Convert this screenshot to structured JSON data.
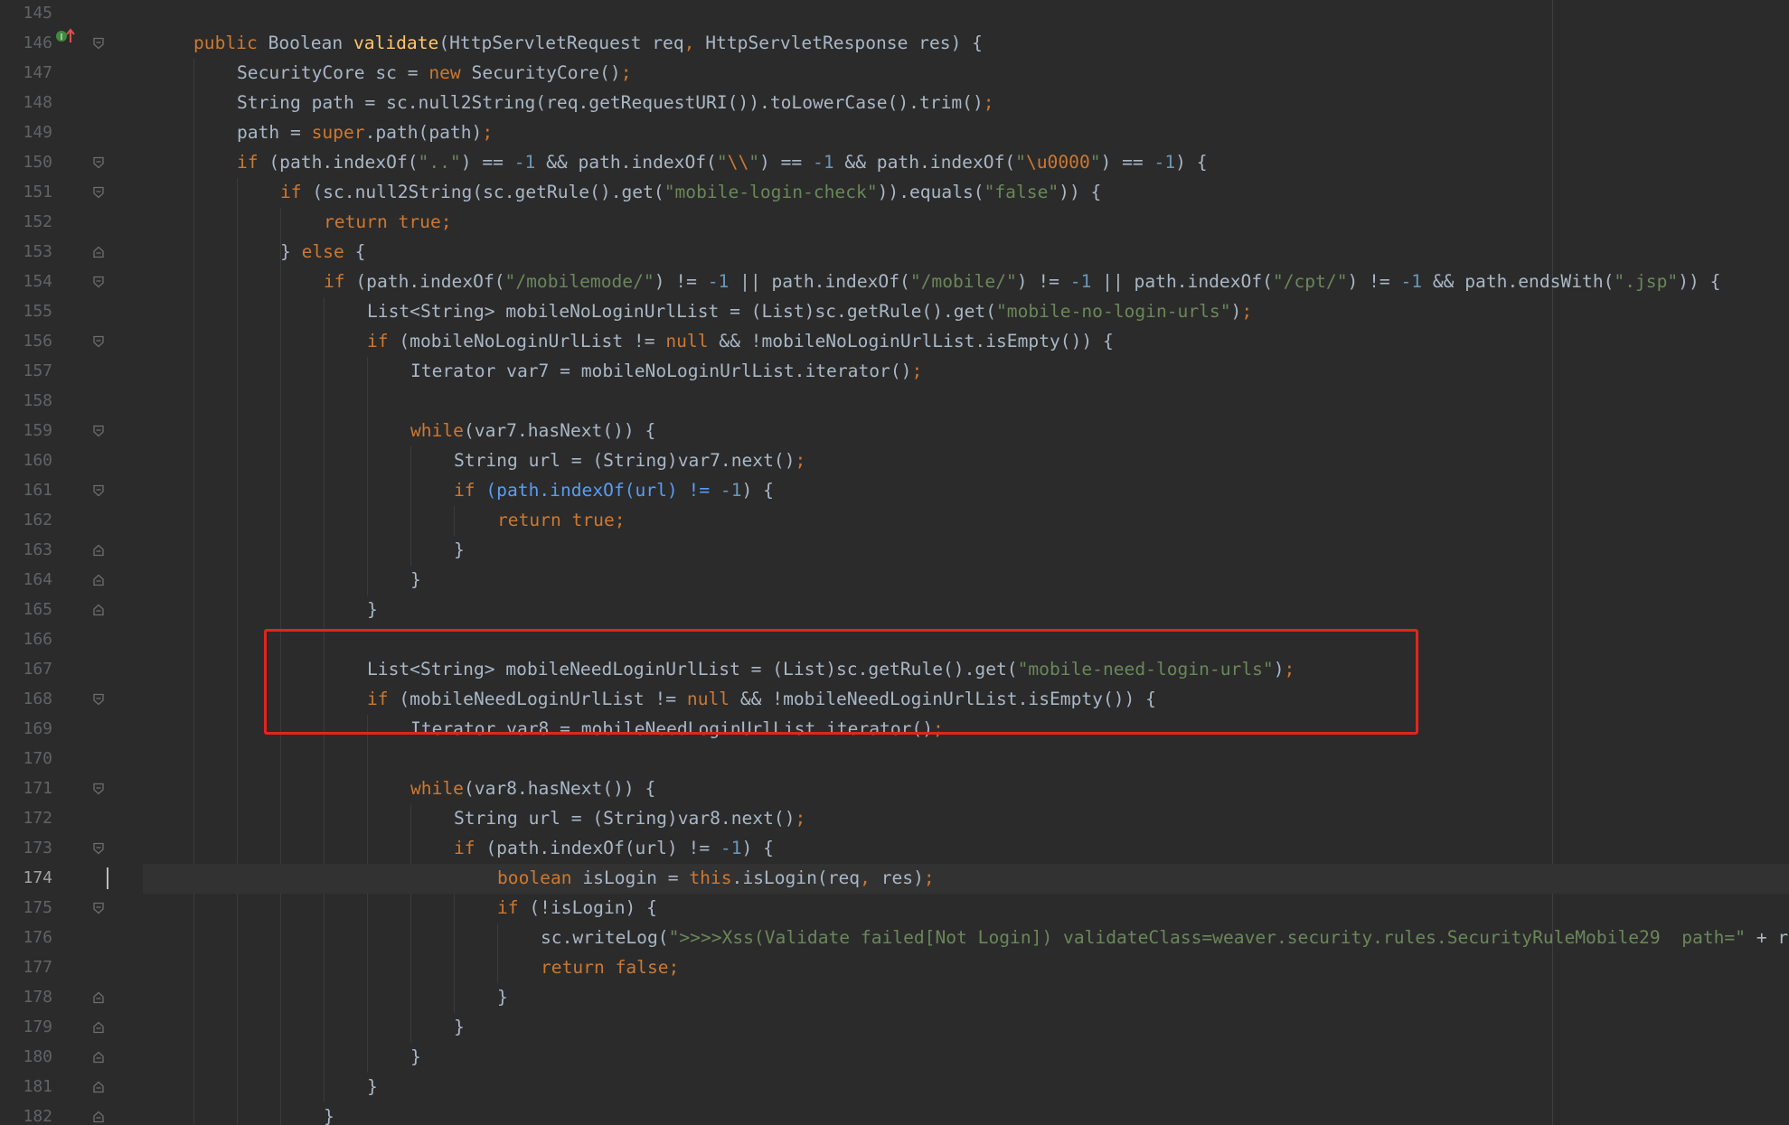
{
  "editor": {
    "current_line": 174,
    "highlight_box": {
      "from_line": 166,
      "to_line": 169
    },
    "colors": {
      "background": "#2b2b2b",
      "keyword": "#cc7832",
      "string": "#6a8759",
      "number": "#6897bb",
      "method_decl": "#ffc66d",
      "text": "#a9b7c6",
      "highlight_box": "#e1251b"
    }
  },
  "gutter": {
    "icons": {
      "line146": "implementing-method-icon"
    }
  },
  "lines": [
    {
      "n": "145",
      "indent": 0,
      "fold": "",
      "tokens": []
    },
    {
      "n": "146",
      "indent": 1,
      "fold": "start",
      "tokens": [
        [
          "kw",
          "public "
        ],
        [
          "p",
          "Boolean "
        ],
        [
          "fn",
          "validate"
        ],
        [
          "p",
          "(HttpServletRequest req"
        ],
        [
          "kw",
          ", "
        ],
        [
          "p",
          "HttpServletResponse res) {"
        ]
      ]
    },
    {
      "n": "147",
      "indent": 2,
      "fold": "",
      "tokens": [
        [
          "p",
          "SecurityCore sc = "
        ],
        [
          "kw",
          "new "
        ],
        [
          "p",
          "SecurityCore()"
        ],
        [
          "kw",
          ";"
        ]
      ]
    },
    {
      "n": "148",
      "indent": 2,
      "fold": "",
      "tokens": [
        [
          "p",
          "String path = sc.null2String(req.getRequestURI()).toLowerCase().trim()"
        ],
        [
          "kw",
          ";"
        ]
      ]
    },
    {
      "n": "149",
      "indent": 2,
      "fold": "",
      "tokens": [
        [
          "p",
          "path = "
        ],
        [
          "kw",
          "super"
        ],
        [
          "p",
          ".path(path)"
        ],
        [
          "kw",
          ";"
        ]
      ]
    },
    {
      "n": "150",
      "indent": 2,
      "fold": "start",
      "tokens": [
        [
          "kw",
          "if "
        ],
        [
          "p",
          "(path.indexOf("
        ],
        [
          "str",
          "\"..\""
        ],
        [
          "p",
          ") == "
        ],
        [
          "num",
          "-1 "
        ],
        [
          "p",
          "&& path.indexOf("
        ],
        [
          "str",
          "\""
        ],
        [
          "esc",
          "\\\\"
        ],
        [
          "str",
          "\""
        ],
        [
          "p",
          ") == "
        ],
        [
          "num",
          "-1 "
        ],
        [
          "p",
          "&& path.indexOf("
        ],
        [
          "str",
          "\""
        ],
        [
          "esc",
          "\\u0000"
        ],
        [
          "str",
          "\""
        ],
        [
          "p",
          ") == "
        ],
        [
          "num",
          "-1"
        ],
        [
          "p",
          ") {"
        ]
      ]
    },
    {
      "n": "151",
      "indent": 3,
      "fold": "start",
      "tokens": [
        [
          "kw",
          "if "
        ],
        [
          "p",
          "(sc.null2String(sc.getRule().get("
        ],
        [
          "str",
          "\"mobile-login-check\""
        ],
        [
          "p",
          ")).equals("
        ],
        [
          "str",
          "\"false\""
        ],
        [
          "p",
          ")) {"
        ]
      ]
    },
    {
      "n": "152",
      "indent": 4,
      "fold": "",
      "tokens": [
        [
          "kw",
          "return true;"
        ]
      ]
    },
    {
      "n": "153",
      "indent": 3,
      "fold": "end",
      "tokens": [
        [
          "p",
          "} "
        ],
        [
          "kw",
          "else "
        ],
        [
          "p",
          "{"
        ]
      ]
    },
    {
      "n": "154",
      "indent": 4,
      "fold": "start",
      "tokens": [
        [
          "kw",
          "if "
        ],
        [
          "p",
          "(path.indexOf("
        ],
        [
          "str",
          "\"/mobilemode/\""
        ],
        [
          "p",
          ") != "
        ],
        [
          "num",
          "-1 "
        ],
        [
          "p",
          "|| path.indexOf("
        ],
        [
          "str",
          "\"/mobile/\""
        ],
        [
          "p",
          ") != "
        ],
        [
          "num",
          "-1 "
        ],
        [
          "p",
          "|| path.indexOf("
        ],
        [
          "str",
          "\"/cpt/\""
        ],
        [
          "p",
          ") != "
        ],
        [
          "num",
          "-1 "
        ],
        [
          "p",
          "&& path.endsWith("
        ],
        [
          "str",
          "\".jsp\""
        ],
        [
          "p",
          ")) {"
        ]
      ]
    },
    {
      "n": "155",
      "indent": 5,
      "fold": "",
      "tokens": [
        [
          "p",
          "List<String> mobileNoLoginUrlList = (List)sc.getRule().get("
        ],
        [
          "str",
          "\"mobile-no-login-urls\""
        ],
        [
          "p",
          ")"
        ],
        [
          "kw",
          ";"
        ]
      ]
    },
    {
      "n": "156",
      "indent": 5,
      "fold": "start",
      "tokens": [
        [
          "kw",
          "if "
        ],
        [
          "p",
          "(mobileNoLoginUrlList != "
        ],
        [
          "kw",
          "null "
        ],
        [
          "p",
          "&& !mobileNoLoginUrlList.isEmpty()) {"
        ]
      ]
    },
    {
      "n": "157",
      "indent": 6,
      "fold": "",
      "tokens": [
        [
          "p",
          "Iterator var7 = mobileNoLoginUrlList.iterator()"
        ],
        [
          "kw",
          ";"
        ]
      ]
    },
    {
      "n": "158",
      "indent": 0,
      "fold": "",
      "tokens": []
    },
    {
      "n": "159",
      "indent": 6,
      "fold": "start",
      "tokens": [
        [
          "kw",
          "while"
        ],
        [
          "p",
          "(var7.hasNext()) {"
        ]
      ]
    },
    {
      "n": "160",
      "indent": 7,
      "fold": "",
      "tokens": [
        [
          "p",
          "String url = (String)var7.next()"
        ],
        [
          "kw",
          ";"
        ]
      ]
    },
    {
      "n": "161",
      "indent": 7,
      "fold": "start",
      "tokens": [
        [
          "kw",
          "if "
        ],
        [
          "blue",
          "(path.indexOf(url) "
        ],
        [
          "blue",
          "!= "
        ],
        [
          "num",
          "-1"
        ],
        [
          "p",
          ") {"
        ]
      ]
    },
    {
      "n": "162",
      "indent": 8,
      "fold": "",
      "tokens": [
        [
          "kw",
          "return true;"
        ]
      ]
    },
    {
      "n": "163",
      "indent": 7,
      "fold": "end",
      "tokens": [
        [
          "p",
          "}"
        ]
      ]
    },
    {
      "n": "164",
      "indent": 6,
      "fold": "end",
      "tokens": [
        [
          "p",
          "}"
        ]
      ]
    },
    {
      "n": "165",
      "indent": 5,
      "fold": "end",
      "tokens": [
        [
          "p",
          "}"
        ]
      ]
    },
    {
      "n": "166",
      "indent": 0,
      "fold": "",
      "tokens": []
    },
    {
      "n": "167",
      "indent": 5,
      "fold": "",
      "tokens": [
        [
          "p",
          "List<String> mobileNeedLoginUrlList = (List)sc.getRule().get("
        ],
        [
          "str",
          "\"mobile-need-login-urls\""
        ],
        [
          "p",
          ")"
        ],
        [
          "kw",
          ";"
        ]
      ]
    },
    {
      "n": "168",
      "indent": 5,
      "fold": "start",
      "tokens": [
        [
          "kw",
          "if "
        ],
        [
          "p",
          "(mobileNeedLoginUrlList != "
        ],
        [
          "kw",
          "null "
        ],
        [
          "p",
          "&& !mobileNeedLoginUrlList.isEmpty()) {"
        ]
      ]
    },
    {
      "n": "169",
      "indent": 6,
      "fold": "",
      "tokens": [
        [
          "p",
          "Iterator var8 = mobileNeedLoginUrlList.iterator()"
        ],
        [
          "kw",
          ";"
        ]
      ]
    },
    {
      "n": "170",
      "indent": 0,
      "fold": "",
      "tokens": []
    },
    {
      "n": "171",
      "indent": 6,
      "fold": "start",
      "tokens": [
        [
          "kw",
          "while"
        ],
        [
          "p",
          "(var8.hasNext()) {"
        ]
      ]
    },
    {
      "n": "172",
      "indent": 7,
      "fold": "",
      "tokens": [
        [
          "p",
          "String url = (String)var8.next()"
        ],
        [
          "kw",
          ";"
        ]
      ]
    },
    {
      "n": "173",
      "indent": 7,
      "fold": "start",
      "tokens": [
        [
          "kw",
          "if "
        ],
        [
          "p",
          "(path.indexOf(url) != "
        ],
        [
          "num",
          "-1"
        ],
        [
          "p",
          ") {"
        ]
      ]
    },
    {
      "n": "174",
      "indent": 8,
      "fold": "",
      "tokens": [
        [
          "kw",
          "boolean "
        ],
        [
          "p",
          "isLogin = "
        ],
        [
          "kw",
          "this"
        ],
        [
          "p",
          ".isLogin(req"
        ],
        [
          "kw",
          ", "
        ],
        [
          "p",
          "res)"
        ],
        [
          "kw",
          ";"
        ]
      ]
    },
    {
      "n": "175",
      "indent": 8,
      "fold": "start",
      "tokens": [
        [
          "kw",
          "if "
        ],
        [
          "p",
          "(!isLogin) {"
        ]
      ]
    },
    {
      "n": "176",
      "indent": 9,
      "fold": "",
      "tokens": [
        [
          "p",
          "sc.writeLog("
        ],
        [
          "str",
          "\">>>>Xss(Validate failed[Not Login]) validateClass=weaver.security.rules.SecurityRuleMobile29  path=\" "
        ],
        [
          "p",
          "+ req"
        ]
      ]
    },
    {
      "n": "177",
      "indent": 9,
      "fold": "",
      "tokens": [
        [
          "kw",
          "return false;"
        ]
      ]
    },
    {
      "n": "178",
      "indent": 8,
      "fold": "end",
      "tokens": [
        [
          "p",
          "}"
        ]
      ]
    },
    {
      "n": "179",
      "indent": 7,
      "fold": "end",
      "tokens": [
        [
          "p",
          "}"
        ]
      ]
    },
    {
      "n": "180",
      "indent": 6,
      "fold": "end",
      "tokens": [
        [
          "p",
          "}"
        ]
      ]
    },
    {
      "n": "181",
      "indent": 5,
      "fold": "end",
      "tokens": [
        [
          "p",
          "}"
        ]
      ]
    },
    {
      "n": "182",
      "indent": 4,
      "fold": "end",
      "tokens": [
        [
          "p",
          "}"
        ]
      ]
    }
  ]
}
